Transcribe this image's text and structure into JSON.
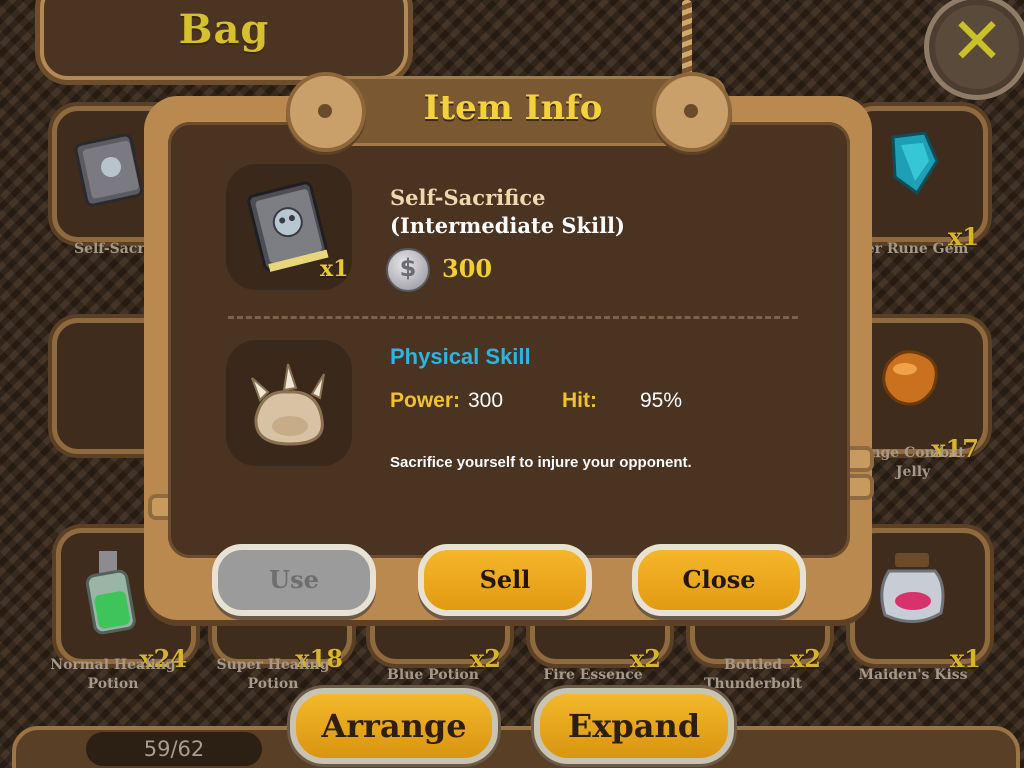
{
  "bag": {
    "title": "Bag",
    "capacity": "59/62",
    "buttons": {
      "arrange": "Arrange",
      "expand": "Expand"
    },
    "slots": [
      {
        "name": "Self-Sacrif",
        "count": ""
      },
      {
        "name": "er Rune Gem",
        "count": "x1"
      },
      {
        "name": "",
        "count": ""
      },
      {
        "name": "ange Combat\nJelly",
        "count": "x17"
      },
      {
        "name": "Normal Healing\nPotion",
        "count": "x24"
      },
      {
        "name": "Super Healing\nPotion",
        "count": "x18"
      },
      {
        "name": "Blue Potion",
        "count": "x2"
      },
      {
        "name": "Fire Essence",
        "count": "x2"
      },
      {
        "name": "Bottled\nThunderbolt",
        "count": "x2"
      },
      {
        "name": "Maiden's Kiss",
        "count": "x1"
      }
    ]
  },
  "item_info": {
    "title": "Item Info",
    "item_name": "Self-Sacrifice",
    "item_subtitle": "(Intermediate Skill)",
    "quantity": "x1",
    "currency_icon": "silver-coin-icon",
    "price": "300",
    "skill_type": "Physical Skill",
    "power_label": "Power:",
    "power_value": "300",
    "hit_label": "Hit:",
    "hit_value": "95%",
    "description": "Sacrifice yourself to injure your opponent.",
    "buttons": {
      "use": "Use",
      "sell": "Sell",
      "close": "Close"
    }
  },
  "colors": {
    "accent_gold": "#f4d23a",
    "skill_blue": "#2ab5e3",
    "panel_brown": "#4a3320",
    "frame_tan": "#b9894f"
  }
}
